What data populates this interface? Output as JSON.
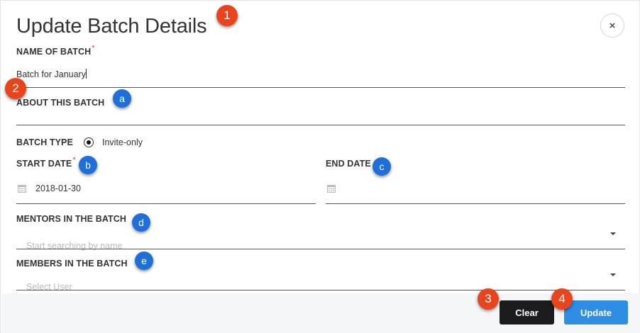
{
  "dialog": {
    "title": "Update Batch Details",
    "close_glyph": "×"
  },
  "form": {
    "name_label": "NAME OF BATCH",
    "required_mark": "*",
    "name_value": "Batch for January",
    "about_label": "ABOUT THIS BATCH",
    "about_value": "",
    "batch_type_label": "BATCH TYPE",
    "batch_type_option": "Invite-only",
    "start_date_label": "START DATE",
    "start_date_value": "2018-01-30",
    "end_date_label": "END DATE",
    "end_date_value": "",
    "mentors_label": "MENTORS IN THE BATCH",
    "mentors_placeholder": "Start searching by name",
    "members_label": "MEMBERS IN THE BATCH",
    "members_placeholder": "Select User"
  },
  "footer": {
    "clear_label": "Clear",
    "update_label": "Update"
  },
  "annotations": {
    "red": [
      "1",
      "2",
      "3",
      "4"
    ],
    "blue": [
      "a",
      "b",
      "c",
      "d",
      "e"
    ]
  },
  "colors": {
    "clear_button": "#1c1c1e",
    "update_button": "#2f8de4",
    "required": "#e53935",
    "red_marker": "#e8441e",
    "blue_marker": "#1e6fd8"
  },
  "icons": [
    "close-icon",
    "calendar-icon",
    "chevron-down-icon",
    "radio-checked-icon"
  ]
}
